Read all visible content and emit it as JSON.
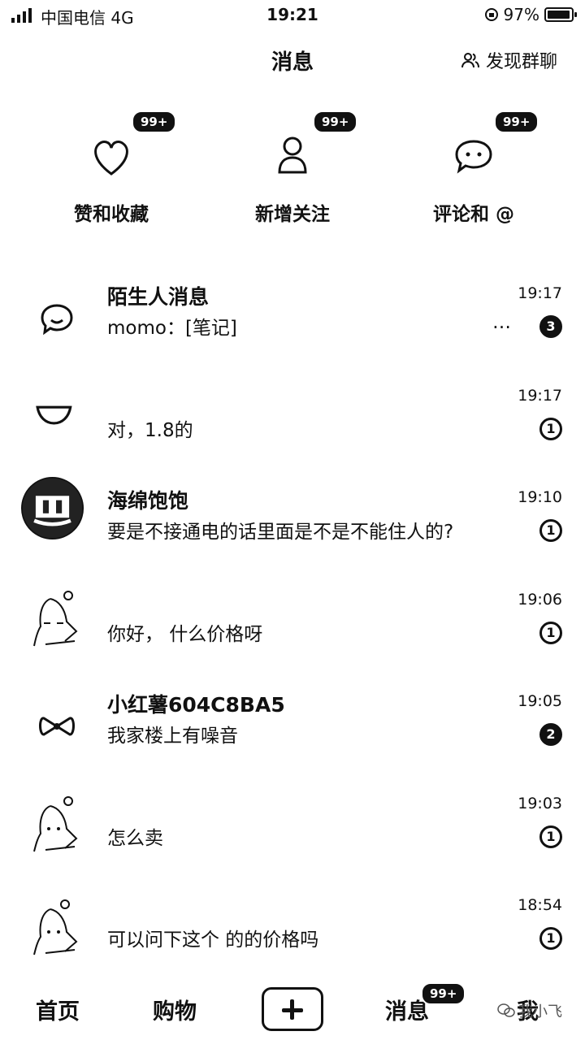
{
  "status_bar": {
    "carrier": "中国电信  4G",
    "time": "19:21",
    "battery": "97%",
    "battery_level": 0.97
  },
  "header": {
    "title": "消息",
    "discover_label": "发现群聊"
  },
  "categories": [
    {
      "label": "赞和收藏",
      "badge": "99+",
      "icon": "heart-icon"
    },
    {
      "label": "新增关注",
      "badge": "99+",
      "icon": "person-icon"
    },
    {
      "label": "评论和 @",
      "badge": "99+",
      "icon": "comment-icon"
    }
  ],
  "messages": [
    {
      "name": "陌生人消息",
      "preview": "momo：[笔记]",
      "ellipsis": "…",
      "time": "19:17",
      "count": "3",
      "count_filled": true
    },
    {
      "name": "",
      "preview": "对，1.8的",
      "time": "19:17",
      "count": "1",
      "count_filled": false
    },
    {
      "name": "海绵饱饱",
      "preview": "要是不接通电的话里面是不是不能住人的?",
      "time": "19:10",
      "count": "1",
      "count_filled": false
    },
    {
      "name": "",
      "preview": "你好，            什么价格呀",
      "time": "19:06",
      "count": "1",
      "count_filled": false
    },
    {
      "name": "小红薯604C8BA5",
      "preview": "我家楼上有噪音",
      "time": "19:05",
      "count": "2",
      "count_filled": true
    },
    {
      "name": "",
      "preview": "怎么卖",
      "time": "19:03",
      "count": "1",
      "count_filled": false
    },
    {
      "name": "",
      "preview": "可以问下这个          的的价格吗",
      "time": "18:54",
      "count": "1",
      "count_filled": false
    }
  ],
  "bottom_nav": {
    "home": "首页",
    "shop": "购物",
    "messages": "消息",
    "messages_badge": "99+",
    "me": "我",
    "watermark": "我小飞"
  }
}
